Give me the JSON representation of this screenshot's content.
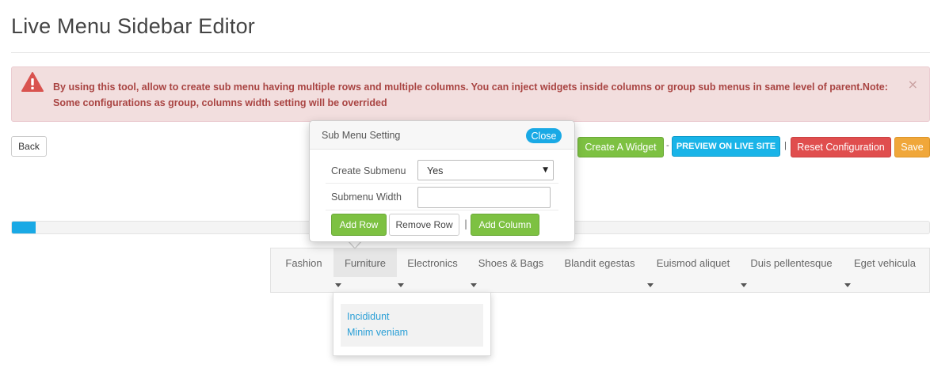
{
  "page": {
    "title": "Live Menu Sidebar Editor"
  },
  "alert": {
    "message": "By using this tool, allow to create sub menu having multiple rows and multiple columns. You can inject widgets inside columns or group sub menus in same level of parent.Note: Some configurations as group, columns width setting will be overrided",
    "close_label": "×",
    "icon": "warning-triangle-icon",
    "color": "#a94442"
  },
  "toolbar": {
    "back_label": "Back",
    "create_widget_label": "Create A Widget",
    "separator_1": "-",
    "preview_label": "PREVIEW ON LIVE SITE",
    "separator_2": "|",
    "reset_label": "Reset Configuration",
    "save_label": "Save"
  },
  "progress": {
    "value_percent": 2.6,
    "color": "#19a9e5"
  },
  "popover": {
    "title": "Sub Menu Setting",
    "close_label": "Close",
    "create_submenu_label": "Create Submenu",
    "create_submenu_value": "Yes",
    "submenu_width_label": "Submenu Width",
    "submenu_width_value": "",
    "add_row_label": "Add Row",
    "remove_row_label": "Remove Row",
    "separator": "|",
    "add_column_label": "Add Column"
  },
  "menu": {
    "items": [
      {
        "label": "Fashion"
      },
      {
        "label": "Furniture"
      },
      {
        "label": "Electronics"
      },
      {
        "label": "Shoes & Bags"
      },
      {
        "label": "Blandit egestas"
      },
      {
        "label": "Euismod aliquet"
      },
      {
        "label": "Duis pellentesque"
      },
      {
        "label": "Eget vehicula"
      }
    ],
    "active_item": "Furniture"
  },
  "submenu": {
    "links": [
      {
        "label": "Incididunt"
      },
      {
        "label": "Minim veniam"
      }
    ]
  },
  "colors": {
    "green": "#7dc142",
    "blue": "#19b4e8",
    "red": "#e04e4e",
    "orange": "#f0a73a"
  }
}
